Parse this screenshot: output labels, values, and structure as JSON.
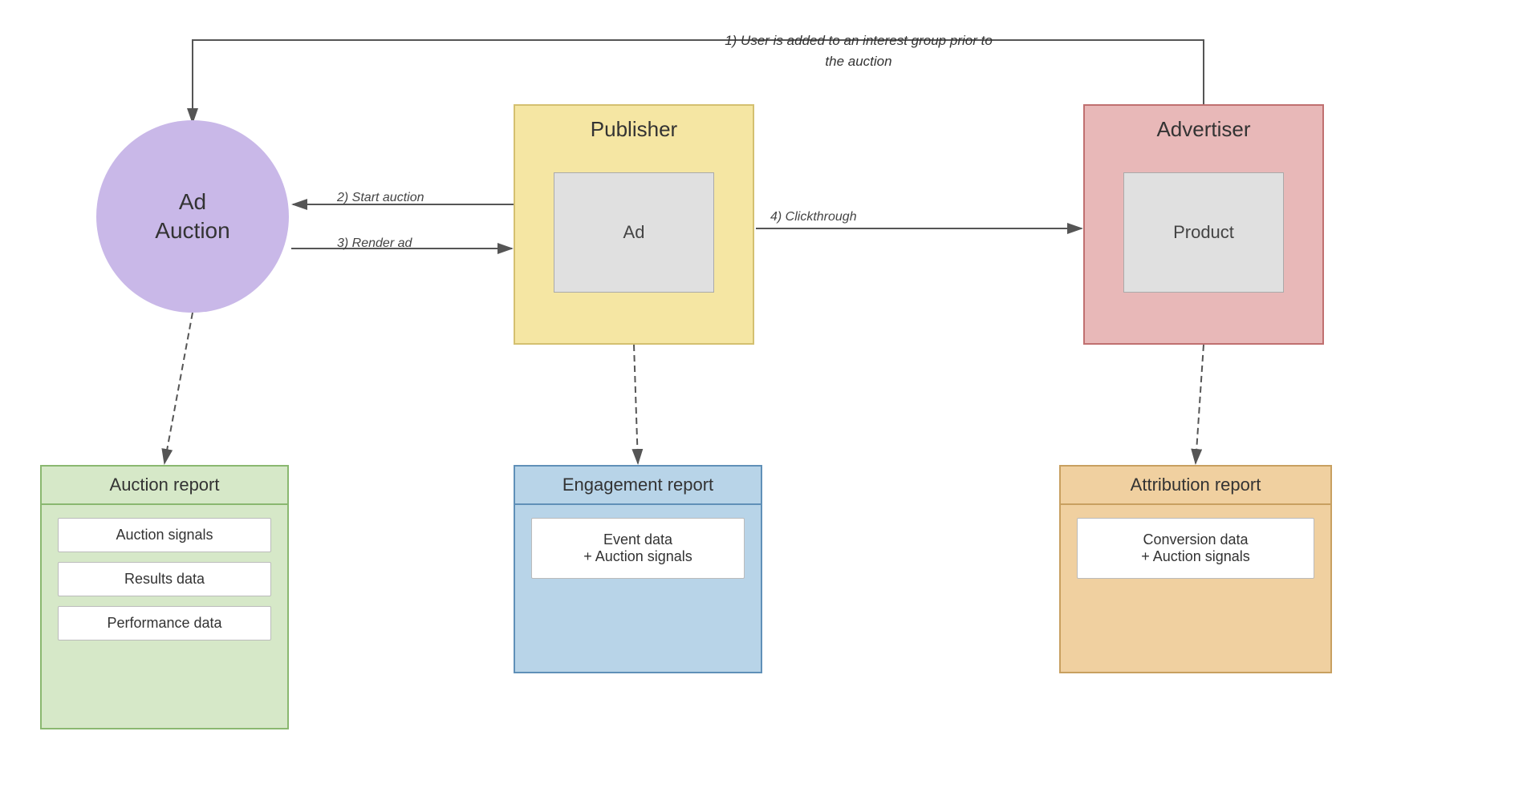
{
  "diagram": {
    "ad_auction": {
      "label_line1": "Ad",
      "label_line2": "Auction"
    },
    "publisher": {
      "title": "Publisher",
      "inner_label": "Ad"
    },
    "advertiser": {
      "title": "Advertiser",
      "inner_label": "Product"
    },
    "interest_group_note": "1) User is added to an interest group prior to the auction",
    "arrow_labels": {
      "start_auction": "2) Start auction",
      "render_ad": "3) Render ad",
      "clickthrough": "4) Clickthrough"
    },
    "auction_report": {
      "title": "Auction report",
      "items": [
        "Auction signals",
        "Results data",
        "Performance data"
      ]
    },
    "engagement_report": {
      "title": "Engagement report",
      "items": [
        "Event data\n+ Auction signals"
      ]
    },
    "attribution_report": {
      "title": "Attribution report",
      "items": [
        "Conversion data\n+ Auction signals"
      ]
    }
  }
}
